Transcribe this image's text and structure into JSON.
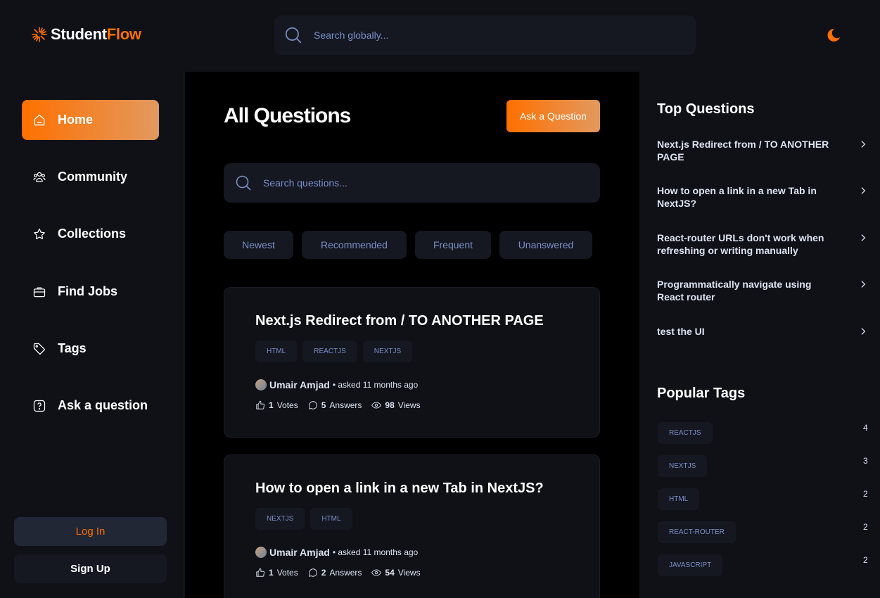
{
  "header": {
    "logo_prefix": "Student",
    "logo_accent": "Flow",
    "search_placeholder": "Search globally...",
    "theme_icon": "moon-icon"
  },
  "sidebar": {
    "items": [
      {
        "label": "Home",
        "icon": "home-icon",
        "active": true
      },
      {
        "label": "Community",
        "icon": "users-icon"
      },
      {
        "label": "Collections",
        "icon": "star-icon"
      },
      {
        "label": "Find Jobs",
        "icon": "briefcase-icon"
      },
      {
        "label": "Tags",
        "icon": "tag-icon"
      },
      {
        "label": "Ask a question",
        "icon": "question-icon"
      }
    ],
    "login_label": "Log In",
    "signup_label": "Sign Up"
  },
  "main": {
    "title": "All Questions",
    "ask_button": "Ask a Question",
    "search_placeholder": "Search questions...",
    "filters": [
      "Newest",
      "Recommended",
      "Frequent",
      "Unanswered"
    ],
    "questions": [
      {
        "title": "Next.js Redirect from / TO ANOTHER PAGE",
        "tags": [
          "HTML",
          "REACTJS",
          "NEXTJS"
        ],
        "author": "Umair Amjad",
        "asked": "• asked 11 months ago",
        "votes": "1",
        "votes_label": "Votes",
        "answers": "5",
        "answers_label": "Answers",
        "views": "98",
        "views_label": "Views"
      },
      {
        "title": "How to open a link in a new Tab in NextJS?",
        "tags": [
          "NEXTJS",
          "HTML"
        ],
        "author": "Umair Amjad",
        "asked": "• asked 11 months ago",
        "votes": "1",
        "votes_label": "Votes",
        "answers": "2",
        "answers_label": "Answers",
        "views": "54",
        "views_label": "Views"
      }
    ]
  },
  "right": {
    "top_title": "Top Questions",
    "top_questions": [
      "Next.js Redirect from / TO ANOTHER PAGE",
      "How to open a link in a new Tab in NextJS?",
      "React-router URLs don't work when refreshing or writing manually",
      "Programmatically navigate using React router",
      "test the UI"
    ],
    "tags_title": "Popular Tags",
    "popular_tags": [
      {
        "name": "REACTJS",
        "count": "4"
      },
      {
        "name": "NEXTJS",
        "count": "3"
      },
      {
        "name": "HTML",
        "count": "2"
      },
      {
        "name": "REACT-ROUTER",
        "count": "2"
      },
      {
        "name": "JAVASCRIPT",
        "count": "2"
      }
    ]
  },
  "colors": {
    "accent": "#ff7000",
    "accent_end": "#e2995f",
    "background": "#0f1117",
    "muted_text": "#7b8ec8"
  }
}
